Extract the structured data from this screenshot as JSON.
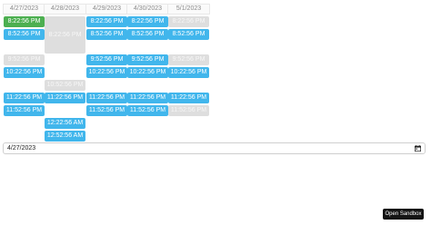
{
  "calendar": {
    "columns": [
      {
        "date": "4/27/2023",
        "slots": [
          {
            "label": "8:22:56 PM",
            "state": "selected"
          },
          {
            "label": "8:52:56 PM",
            "state": "available"
          },
          {
            "label": "9:52:56 PM",
            "state": "disabled"
          },
          {
            "label": "10:22:56 PM",
            "state": "available"
          },
          {
            "label": "11:22:56 PM",
            "state": "available"
          },
          {
            "label": "11:52:56 PM",
            "state": "available"
          }
        ]
      },
      {
        "date": "4/28/2023",
        "slots": [
          {
            "label": "8:22:56 PM",
            "state": "disabled"
          },
          {
            "label": "10:52:56 PM",
            "state": "disabled"
          },
          {
            "label": "11:22:56 PM",
            "state": "available"
          },
          {
            "label": "12:22:56 AM",
            "state": "available"
          },
          {
            "label": "12:52:56 AM",
            "state": "available"
          }
        ]
      },
      {
        "date": "4/29/2023",
        "slots": [
          {
            "label": "8:22:56 PM",
            "state": "available"
          },
          {
            "label": "8:52:56 PM",
            "state": "available"
          },
          {
            "label": "9:52:56 PM",
            "state": "available"
          },
          {
            "label": "10:22:56 PM",
            "state": "available"
          },
          {
            "label": "11:22:56 PM",
            "state": "available"
          },
          {
            "label": "11:52:56 PM",
            "state": "available"
          }
        ]
      },
      {
        "date": "4/30/2023",
        "slots": [
          {
            "label": "8:22:56 PM",
            "state": "available"
          },
          {
            "label": "8:52:56 PM",
            "state": "available"
          },
          {
            "label": "9:52:56 PM",
            "state": "available"
          },
          {
            "label": "10:22:56 PM",
            "state": "available"
          },
          {
            "label": "11:22:56 PM",
            "state": "available"
          },
          {
            "label": "11:52:56 PM",
            "state": "available"
          }
        ]
      },
      {
        "date": "5/1/2023",
        "slots": [
          {
            "label": "8:22:56 PM",
            "state": "disabled"
          },
          {
            "label": "8:52:56 PM",
            "state": "available"
          },
          {
            "label": "9:52:56 PM",
            "state": "disabled"
          },
          {
            "label": "10:22:56 PM",
            "state": "available"
          },
          {
            "label": "11:22:56 PM",
            "state": "available"
          },
          {
            "label": "11:52:56 PM",
            "state": "disabled"
          }
        ]
      }
    ]
  },
  "date_input": {
    "value": "4/27/2023",
    "icon": "calendar-icon"
  },
  "sandbox_button": {
    "label": "Open Sandbox"
  },
  "colors": {
    "available": "#41b6ec",
    "selected": "#4caf50",
    "disabled": "#dedede",
    "button": "#141414"
  }
}
